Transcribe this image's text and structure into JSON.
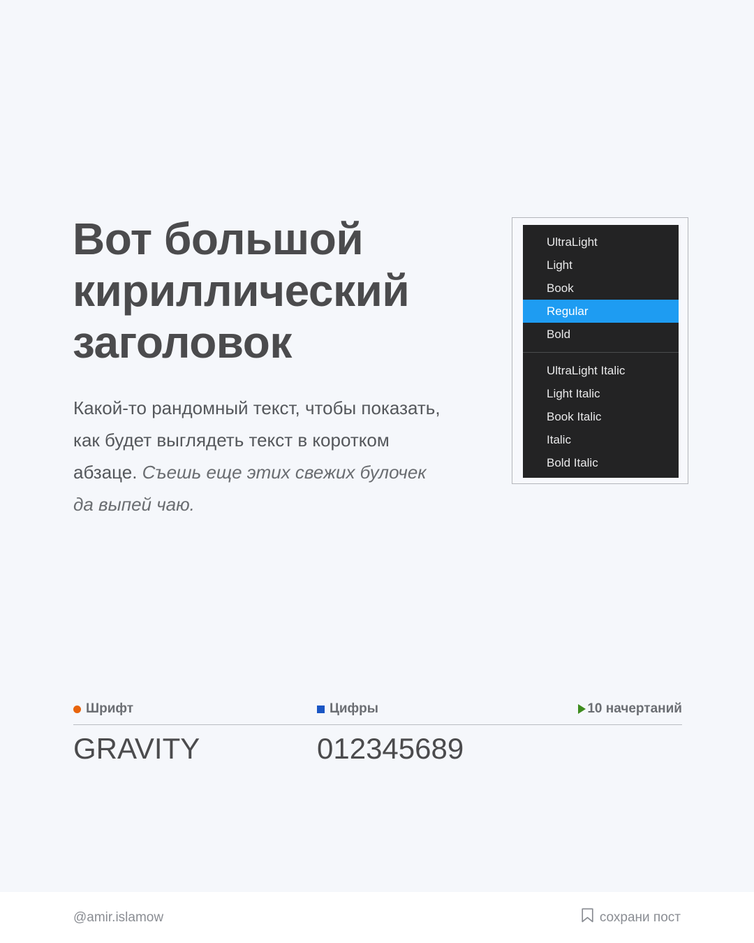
{
  "theme": {
    "page_background": "#ffffff",
    "stage_background": "#f5f7fb",
    "footer_background": "#ffffff",
    "heading_color": "#4b4b4d",
    "body_color": "#55585c",
    "menu_background": "#232324",
    "menu_text_color": "#e9e9ea",
    "menu_selected_background": "#1e9cf2",
    "marker_font_color": "#e8640c",
    "marker_digits_color": "#1a56c4",
    "marker_styles_color": "#3e8c1e",
    "muted_color": "#8a8d93",
    "rule_color": "#b9bcc2",
    "frame_border_color": "#b4b6bb"
  },
  "hero": {
    "headline": "Вот большой кириллический заголовок",
    "paragraph_regular": "Какой-то рандомный текст, чтобы показать, как будет выглядеть текст в коротком абзаце. ",
    "paragraph_italic": "Съешь еще этих свежих булочек да выпей чаю."
  },
  "style_menu": {
    "groups": [
      {
        "items": [
          {
            "label": "UltraLight",
            "selected": false
          },
          {
            "label": "Light",
            "selected": false
          },
          {
            "label": "Book",
            "selected": false
          },
          {
            "label": "Regular",
            "selected": true
          },
          {
            "label": "Bold",
            "selected": false
          }
        ]
      },
      {
        "items": [
          {
            "label": "UltraLight Italic",
            "selected": false
          },
          {
            "label": "Light Italic",
            "selected": false
          },
          {
            "label": "Book Italic",
            "selected": false
          },
          {
            "label": "Italic",
            "selected": false
          },
          {
            "label": "Bold Italic",
            "selected": false
          }
        ]
      }
    ]
  },
  "stats": {
    "font": {
      "marker": "orange-circle-marker",
      "label": "Шрифт",
      "value": "GRAVITY"
    },
    "digits": {
      "marker": "blue-square-marker",
      "label": "Цифры",
      "value": "012345689"
    },
    "styles": {
      "marker": "green-triangle-marker",
      "label": "10 начертаний"
    }
  },
  "footer": {
    "handle": "@amir.islamow",
    "save_icon": "bookmark-icon",
    "save_label": "сохрани пост"
  }
}
